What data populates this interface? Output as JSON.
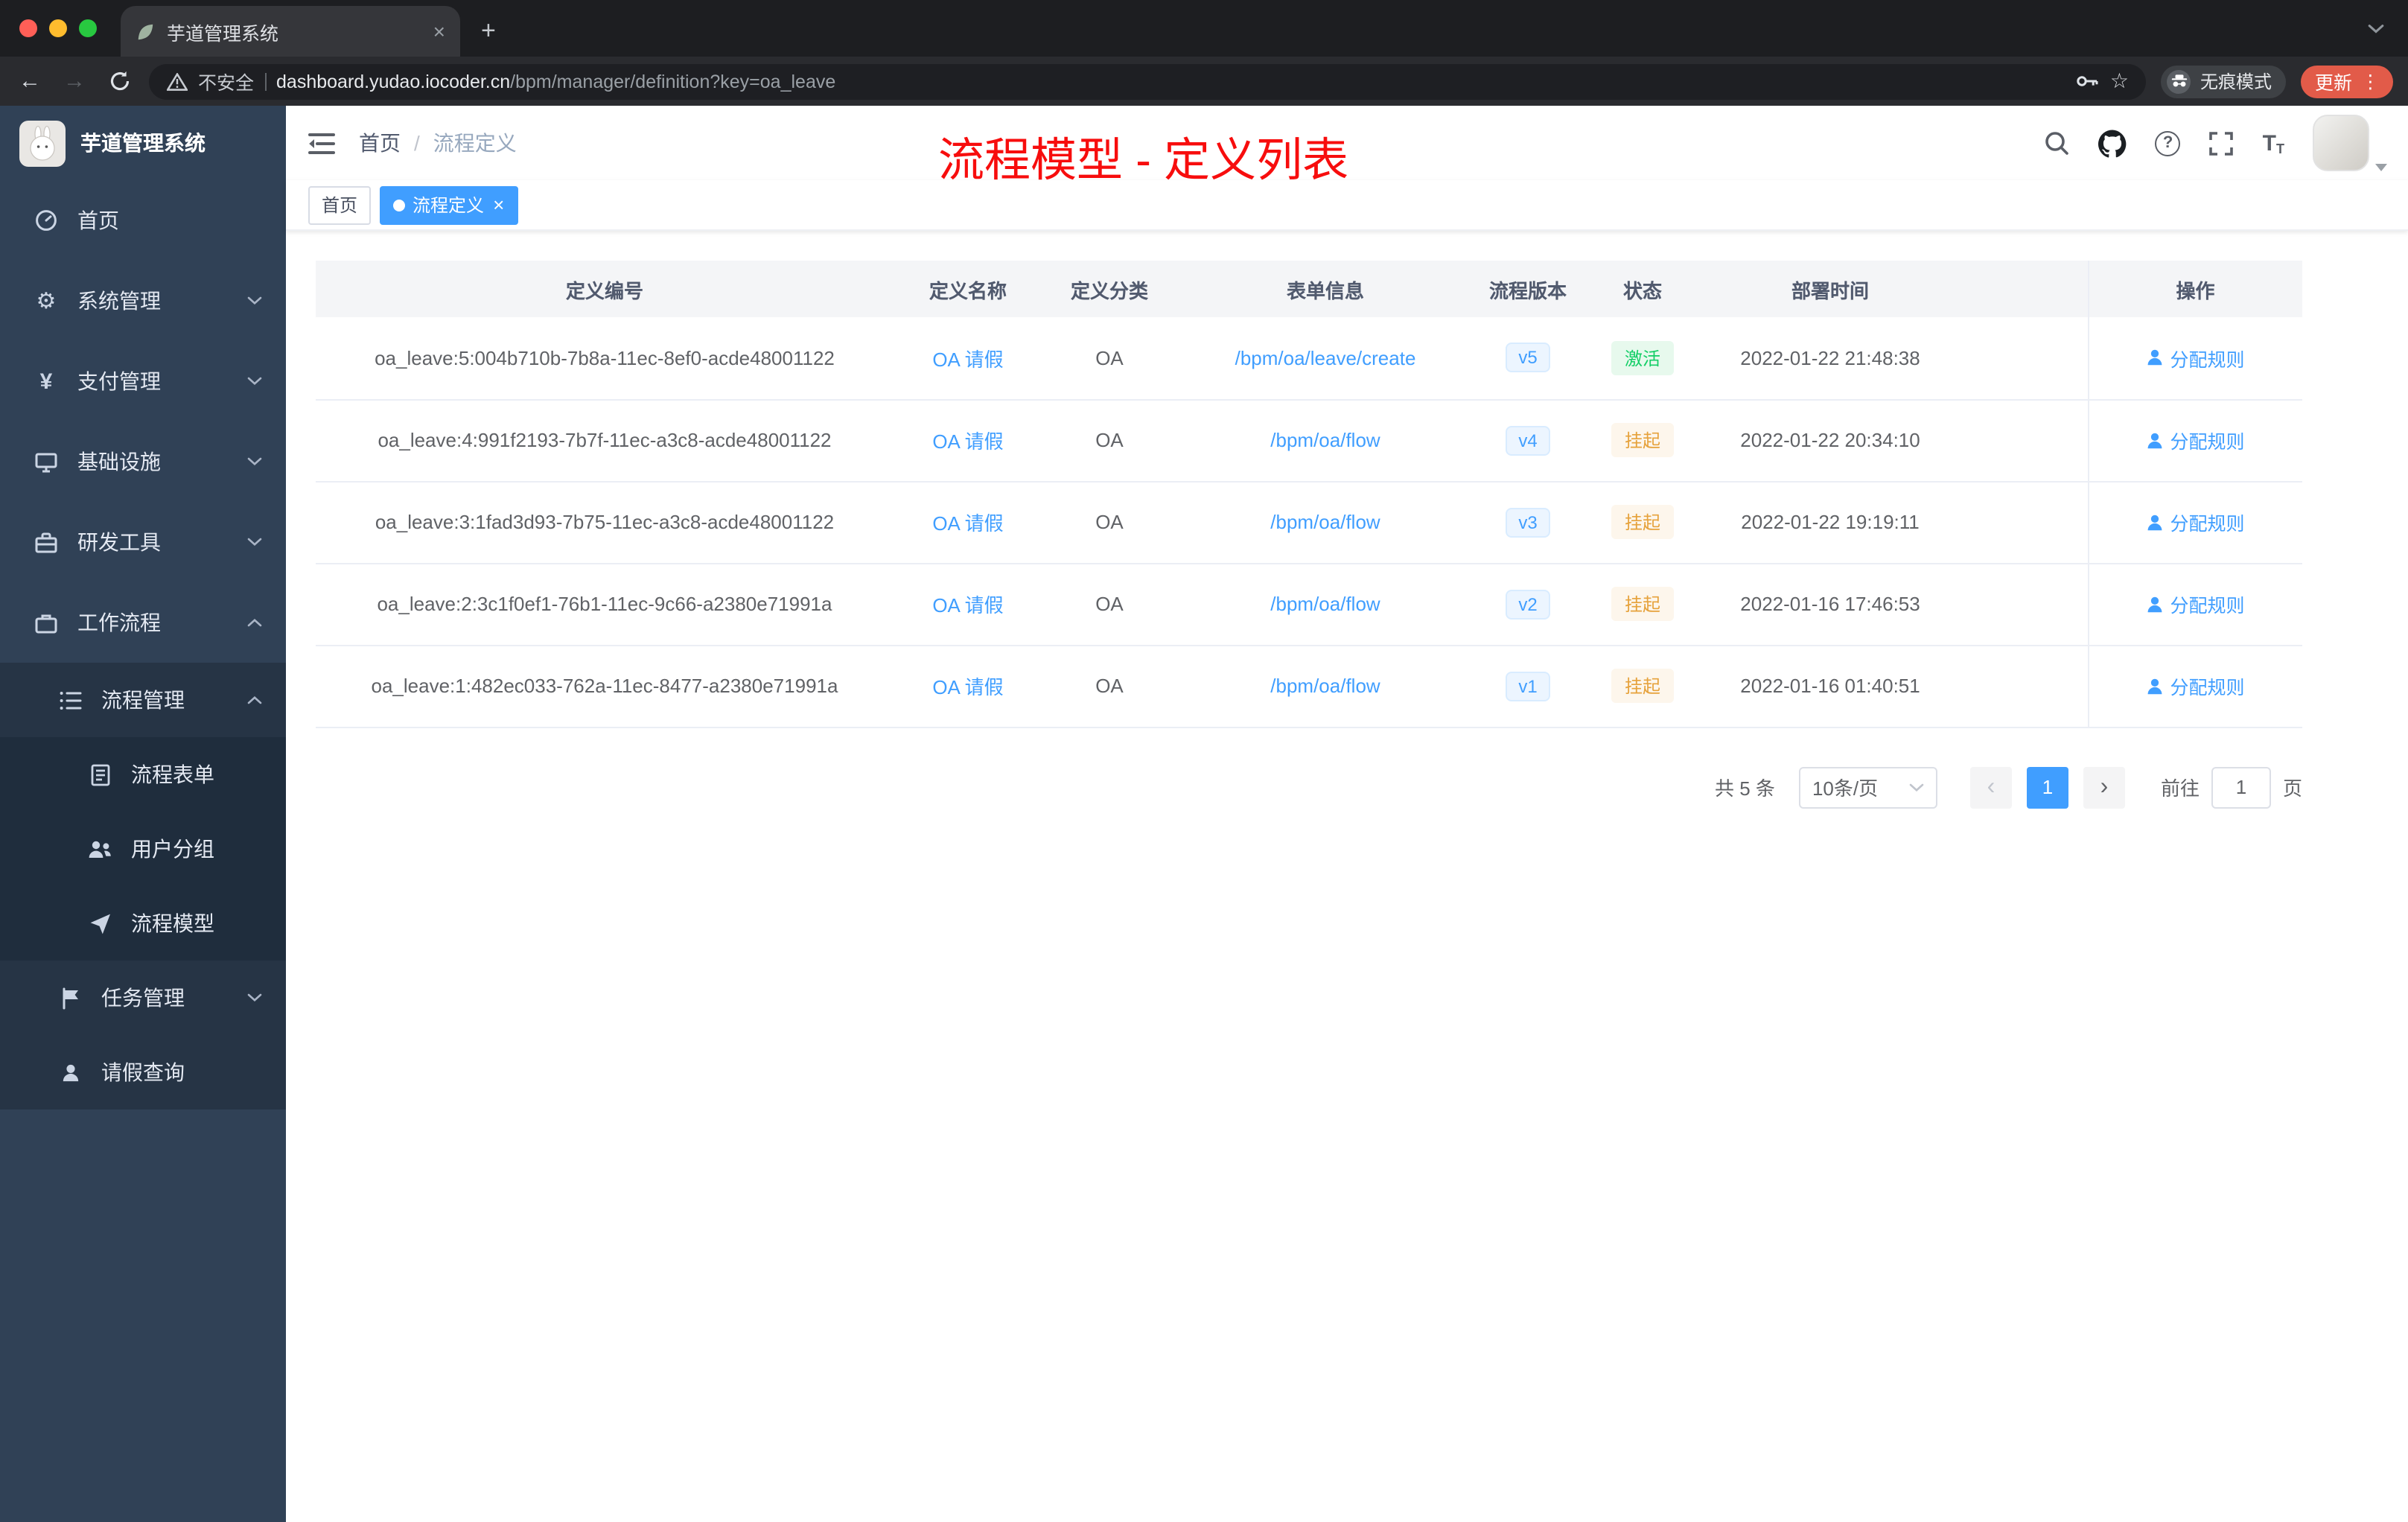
{
  "colors": {
    "accent": "#409eff",
    "annotation_red": "#f70d0d",
    "status_active": "#13ce66",
    "status_suspended": "#e6a23c",
    "sidebar_bg": "#304156"
  },
  "icons": {
    "close": "×",
    "new_tab": "+",
    "back": "←",
    "forward": "→",
    "star": "☆",
    "kebab": "⋮",
    "gear": "⚙",
    "yen": "¥",
    "question": "?",
    "prev": "‹",
    "next": "›",
    "font_large": "T",
    "font_small": "T"
  },
  "browser": {
    "tab_title": "芋道管理系统",
    "security_label": "不安全",
    "url_domain": "dashboard.yudao.iocoder.cn",
    "url_path": "/bpm/manager/definition?key=oa_leave",
    "incognito_label": "无痕模式",
    "update_label": "更新"
  },
  "sidebar": {
    "brand": "芋道管理系统",
    "items": [
      {
        "label": "首页"
      },
      {
        "label": "系统管理"
      },
      {
        "label": "支付管理"
      },
      {
        "label": "基础设施"
      },
      {
        "label": "研发工具"
      },
      {
        "label": "工作流程"
      },
      {
        "label": "流程管理"
      },
      {
        "label": "流程表单"
      },
      {
        "label": "用户分组"
      },
      {
        "label": "流程模型"
      },
      {
        "label": "任务管理"
      },
      {
        "label": "请假查询"
      }
    ]
  },
  "header": {
    "breadcrumb_home": "首页",
    "breadcrumb_sep": "/",
    "breadcrumb_current": "流程定义",
    "annotation": "流程模型 - 定义列表"
  },
  "tags": {
    "home": "首页",
    "active": "流程定义"
  },
  "table": {
    "headers": [
      "定义编号",
      "定义名称",
      "定义分类",
      "表单信息",
      "流程版本",
      "状态",
      "部署时间",
      "操作"
    ],
    "rows": [
      {
        "id": "oa_leave:5:004b710b-7b8a-11ec-8ef0-acde48001122",
        "name": "OA 请假",
        "category": "OA",
        "form": "/bpm/oa/leave/create",
        "version": "v5",
        "status": "激活",
        "time": "2022-01-22 21:48:38",
        "action": "分配规则"
      },
      {
        "id": "oa_leave:4:991f2193-7b7f-11ec-a3c8-acde48001122",
        "name": "OA 请假",
        "category": "OA",
        "form": "/bpm/oa/flow",
        "version": "v4",
        "status": "挂起",
        "time": "2022-01-22 20:34:10",
        "action": "分配规则"
      },
      {
        "id": "oa_leave:3:1fad3d93-7b75-11ec-a3c8-acde48001122",
        "name": "OA 请假",
        "category": "OA",
        "form": "/bpm/oa/flow",
        "version": "v3",
        "status": "挂起",
        "time": "2022-01-22 19:19:11",
        "action": "分配规则"
      },
      {
        "id": "oa_leave:2:3c1f0ef1-76b1-11ec-9c66-a2380e71991a",
        "name": "OA 请假",
        "category": "OA",
        "form": "/bpm/oa/flow",
        "version": "v2",
        "status": "挂起",
        "time": "2022-01-16 17:46:53",
        "action": "分配规则"
      },
      {
        "id": "oa_leave:1:482ec033-762a-11ec-8477-a2380e71991a",
        "name": "OA 请假",
        "category": "OA",
        "form": "/bpm/oa/flow",
        "version": "v1",
        "status": "挂起",
        "time": "2022-01-16 01:40:51",
        "action": "分配规则"
      }
    ]
  },
  "pagination": {
    "total": "共 5 条",
    "page_size": "10条/页",
    "current_page": "1",
    "goto_label": "前往",
    "goto_value": "1",
    "page_unit": "页"
  }
}
